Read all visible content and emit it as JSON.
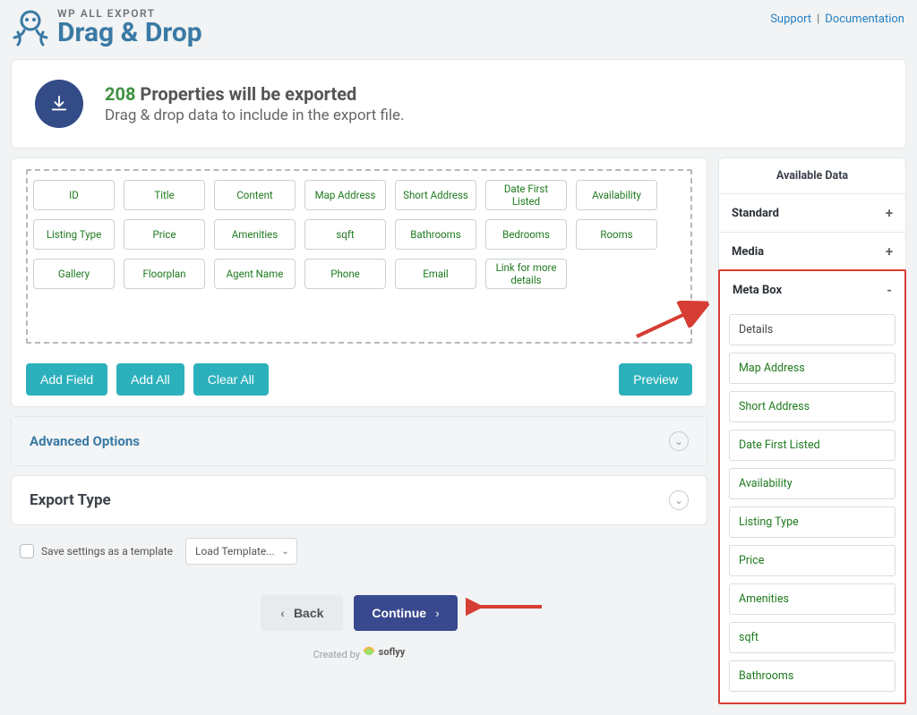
{
  "header": {
    "brand_small": "WP ALL EXPORT",
    "brand_large": "Drag & Drop",
    "support": "Support",
    "documentation": "Documentation"
  },
  "summary": {
    "count": "208",
    "headline_rest": "Properties will be exported",
    "subline": "Drag & drop data to include in the export file."
  },
  "builder": {
    "fields": [
      "ID",
      "Title",
      "Content",
      "Map Address",
      "Short Address",
      "Date First Listed",
      "Availability",
      "Listing Type",
      "Price",
      "Amenities",
      "sqft",
      "Bathrooms",
      "Bedrooms",
      "Rooms",
      "Gallery",
      "Floorplan",
      "Agent Name",
      "Phone",
      "Email",
      "Link for more details"
    ],
    "add_field": "Add Field",
    "add_all": "Add All",
    "clear_all": "Clear All",
    "preview": "Preview"
  },
  "sections": {
    "advanced": "Advanced Options",
    "export_type": "Export Type"
  },
  "save": {
    "label": "Save settings as a template",
    "template_placeholder": "Load Template..."
  },
  "nav": {
    "back": "Back",
    "continue": "Continue"
  },
  "credit": {
    "created_by": "Created by",
    "brand": "soflyy"
  },
  "right": {
    "title": "Available Data",
    "groups": {
      "standard": "Standard",
      "media": "Media",
      "meta_box": "Meta Box"
    },
    "meta_items": [
      {
        "label": "Details",
        "plain": true
      },
      {
        "label": "Map Address"
      },
      {
        "label": "Short Address"
      },
      {
        "label": "Date First Listed"
      },
      {
        "label": "Availability"
      },
      {
        "label": "Listing Type"
      },
      {
        "label": "Price"
      },
      {
        "label": "Amenities"
      },
      {
        "label": "sqft"
      },
      {
        "label": "Bathrooms"
      }
    ]
  }
}
